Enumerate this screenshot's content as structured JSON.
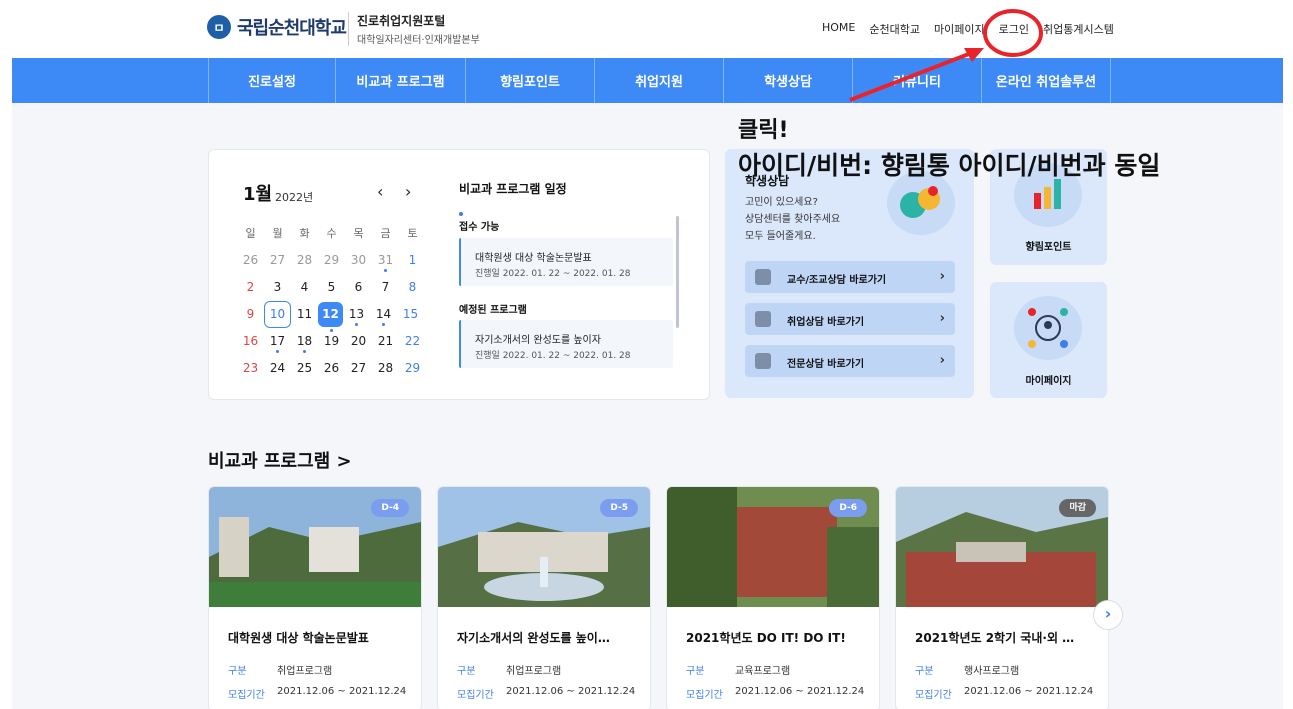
{
  "header": {
    "logo_mark": "ㅁ",
    "logo_name": "국립순천대학교",
    "portal_title": "진로취업지원포털",
    "portal_sub": "대학일자리센터·인재개발본부",
    "topnav": [
      "HOME",
      "순천대학교",
      "마이페이지",
      "로그인",
      "취업통계시스템"
    ]
  },
  "mainnav": [
    "진로설정",
    "비교과 프로그램",
    "향림포인트",
    "취업지원",
    "학생상담",
    "커뮤니티",
    "온라인 취업솔루션"
  ],
  "calendar": {
    "month": "1월",
    "year": "2022년",
    "prev": "‹",
    "next": "›",
    "weekdays": [
      "일",
      "월",
      "화",
      "수",
      "목",
      "금",
      "토"
    ],
    "weeks": [
      [
        "26",
        "27",
        "28",
        "29",
        "30",
        "31",
        "1"
      ],
      [
        "2",
        "3",
        "4",
        "5",
        "6",
        "7",
        "8"
      ],
      [
        "9",
        "10",
        "11",
        "12",
        "13",
        "14",
        "15"
      ],
      [
        "16",
        "17",
        "18",
        "19",
        "20",
        "21",
        "22"
      ],
      [
        "23",
        "24",
        "25",
        "26",
        "27",
        "28",
        "29"
      ]
    ]
  },
  "schedule": {
    "title": "비교과 프로그램 일정",
    "section_open": "접수 가능",
    "section_planned": "예정된 프로그램",
    "items": [
      {
        "title": "대학원생 대상 학술논문발표",
        "date": "진행일  2022. 01. 22 ~ 2022. 01. 28"
      },
      {
        "title": "자기소개서의 완성도를 높이자",
        "date": "진행일  2022. 01. 22 ~ 2022. 01. 28"
      }
    ]
  },
  "counsel": {
    "title": "학생상담",
    "desc": "고민이 있으세요?\n상담센터를 찾아주세요\n모두 들어줄게요.",
    "buttons": [
      "교수/조교상담 바로가기",
      "취업상담 바로가기",
      "전문상담 바로가기"
    ]
  },
  "small_cards": [
    "향림포인트",
    "마이페이지"
  ],
  "annotation": {
    "line1": "클릭!",
    "line2": "아이디/비번: 향림통 아이디/비번과 동일",
    "color": "#e8242a"
  },
  "programs": {
    "section_title": "비교과 프로그램 >",
    "label_category": "구분",
    "label_period": "모집기간",
    "next": "›",
    "cards": [
      {
        "badge": "D-4",
        "title": "대학원생 대상 학술논문발표",
        "category": "취업프로그램",
        "period": "2021.12.06 ~ 2021.12.24"
      },
      {
        "badge": "D-5",
        "title": "자기소개서의 완성도를 높이…",
        "category": "취업프로그램",
        "period": "2021.12.06 ~ 2021.12.24"
      },
      {
        "badge": "D-6",
        "title": "2021학년도 DO IT! DO IT!",
        "category": "교육프로그램",
        "period": "2021.12.06 ~ 2021.12.24"
      },
      {
        "badge": "마감",
        "title": "2021학년도 2학기 국내·외 …",
        "category": "행사프로그램",
        "period": "2021.12.06 ~ 2021.12.24"
      }
    ]
  },
  "colors": {
    "brand_blue": "#3d8af7",
    "sunday": "#e0453f",
    "saturday": "#3d7ef0",
    "badge_active": "#7b9df0",
    "badge_closed": "#666666"
  }
}
